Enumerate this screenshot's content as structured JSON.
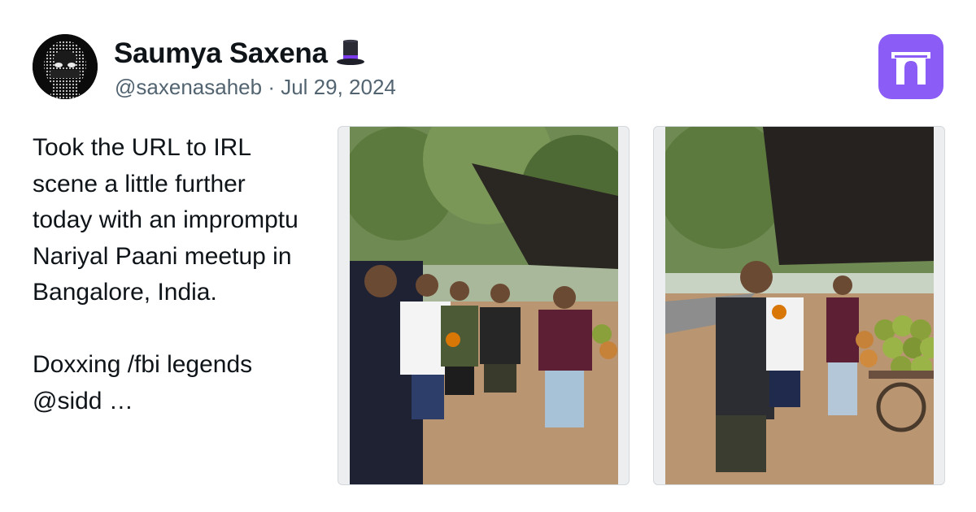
{
  "author": {
    "name": "Saumya Saxena",
    "name_emoji": "tophat-icon",
    "handle": "@saxenasaheb",
    "separator": "·",
    "date": "Jul 29, 2024"
  },
  "tweet": {
    "text": "Took the URL to IRL scene a little further today with an impromptu Nariyal Paani meetup in Bangalore, India.\n\nDoxxing /fbi legends @sidd …"
  },
  "media": {
    "photo_count": 2
  },
  "colors": {
    "name_text": "#0f1419",
    "meta_text": "#536471",
    "logo_bg": "#8b5cf6",
    "card_bg": "#eceef0"
  }
}
